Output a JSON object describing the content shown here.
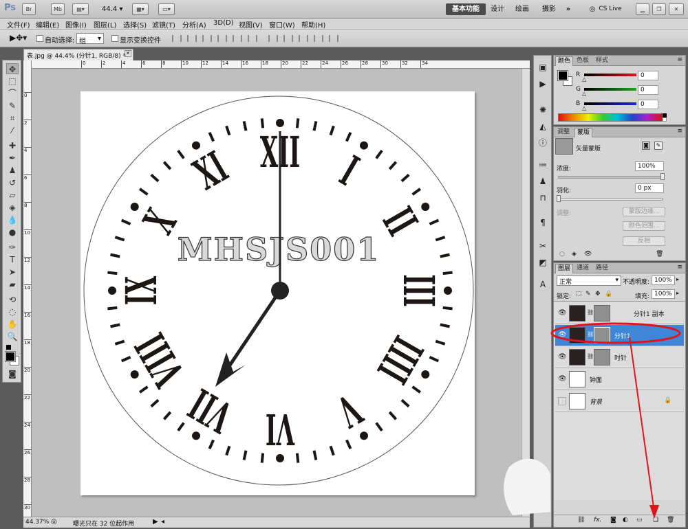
{
  "app": {
    "logo": "Ps",
    "zoom_value": "44.4",
    "workspaces": [
      "基本功能",
      "设计",
      "绘画",
      "摄影"
    ],
    "more": "»",
    "cs_live": "CS Live"
  },
  "menu": [
    "文件(F)",
    "编辑(E)",
    "图像(I)",
    "图层(L)",
    "选择(S)",
    "滤镜(T)",
    "分析(A)",
    "3D(D)",
    "视图(V)",
    "窗口(W)",
    "帮助(H)"
  ],
  "options": {
    "auto_select_label": "自动选择:",
    "auto_select_value": "组",
    "show_transform_label": "显示变换控件"
  },
  "document": {
    "tab_title": "表.jpg @ 44.4% (分针1, RGB/8) *",
    "canvas_text": "MHSJS001",
    "h_ruler_ticks": [
      "0",
      "2",
      "4",
      "6",
      "8",
      "10",
      "12",
      "14",
      "16",
      "18",
      "20",
      "22",
      "24",
      "26",
      "28",
      "30",
      "32",
      "34"
    ],
    "v_ruler_ticks": [
      "0",
      "2",
      "4",
      "6",
      "8",
      "10",
      "12",
      "14",
      "16",
      "18",
      "20",
      "22",
      "24",
      "26",
      "28",
      "30"
    ]
  },
  "status": {
    "zoom": "44.37%",
    "info": "曝光只在 32 位起作用"
  },
  "color_panel": {
    "tabs": [
      "颜色",
      "色板",
      "样式"
    ],
    "channels": [
      {
        "label": "R",
        "value": "0",
        "color": "#d81818"
      },
      {
        "label": "G",
        "value": "0",
        "color": "#1ea81e"
      },
      {
        "label": "B",
        "value": "0",
        "color": "#1c2ad0"
      }
    ]
  },
  "mask_panel": {
    "tabs": [
      "调整",
      "蒙版"
    ],
    "mask_type": "矢量蒙版",
    "density_label": "浓度:",
    "density_value": "100%",
    "feather_label": "羽化:",
    "feather_value": "0 px",
    "adjust_label": "调整:",
    "buttons": [
      "蒙版边缘...",
      "颜色范围...",
      "反相"
    ]
  },
  "layers_panel": {
    "tabs": [
      "图层",
      "通道",
      "路径"
    ],
    "blend_mode": "正常",
    "opacity_label": "不透明度:",
    "opacity_value": "100%",
    "lock_label": "锁定:",
    "fill_label": "填充:",
    "fill_value": "100%",
    "layers": [
      {
        "name": "分针1 副本",
        "visible": true,
        "selected": false
      },
      {
        "name": "分针1",
        "visible": true,
        "selected": true
      },
      {
        "name": "时针",
        "visible": true,
        "selected": false
      },
      {
        "name": "钟面",
        "visible": true,
        "selected": false
      },
      {
        "name": "背景",
        "visible": false,
        "selected": false
      }
    ]
  },
  "annotation": {
    "highlight_color": "#e0141b"
  }
}
